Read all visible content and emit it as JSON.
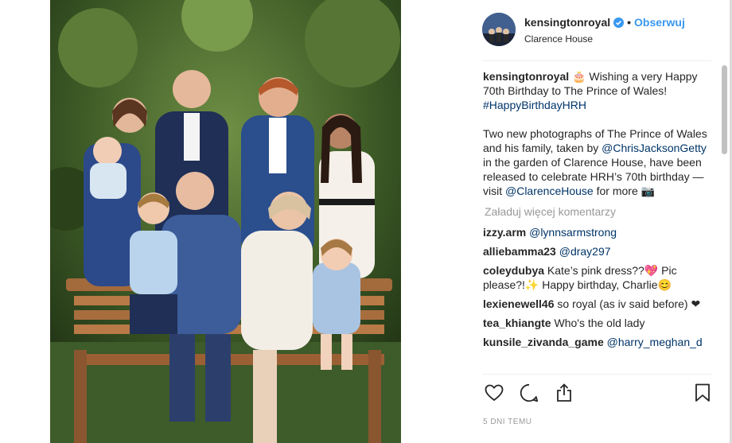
{
  "post": {
    "username": "kensingtonroyal",
    "follow_label": "Obserwuj",
    "dot": "•",
    "location": "Clarence House",
    "caption_user": "kensingtonroyal",
    "caption_line1": " 🎂 Wishing a very Happy 70th Birthday to The Prince of Wales! ",
    "caption_hashtag": "#HappyBirthdayHRH",
    "caption_p2_a": "Two new photographs of The Prince of Wales and his family, taken by ",
    "caption_mention1": "@ChrisJacksonGetty",
    "caption_p2_b": " in the garden of Clarence House, have been released to celebrate HRH’s 70th birthday — visit ",
    "caption_mention2": "@ClarenceHouse",
    "caption_p2_c": " for more 📷",
    "load_more": "Załaduj więcej komentarzy",
    "timestamp": "5 DNI TEMU"
  },
  "comments": [
    {
      "user": "izzy.arm",
      "text": "",
      "mention": "@lynnsarmstrong"
    },
    {
      "user": "alliebamma23",
      "text": "",
      "mention": "@dray297"
    },
    {
      "user": "coleydubya",
      "text": "Kate’s pink dress??💖 Pic please?!✨ Happy birthday, Charlie😊",
      "mention": ""
    },
    {
      "user": "lexienewell46",
      "text": "so royal (as iv said before) ❤",
      "mention": ""
    },
    {
      "user": "tea_khiangte",
      "text": "Who's the old lady",
      "mention": ""
    },
    {
      "user": "kunsile_zivanda_game",
      "text": "",
      "mention": "@harry_meghan_d"
    }
  ],
  "icons": {
    "like": "heart-icon",
    "comment": "comment-bubble-icon",
    "share": "share-icon",
    "save": "bookmark-icon",
    "verified": "verified-badge-icon"
  },
  "colors": {
    "link": "#003569",
    "follow": "#3897f0",
    "muted": "#999999",
    "text": "#262626"
  }
}
